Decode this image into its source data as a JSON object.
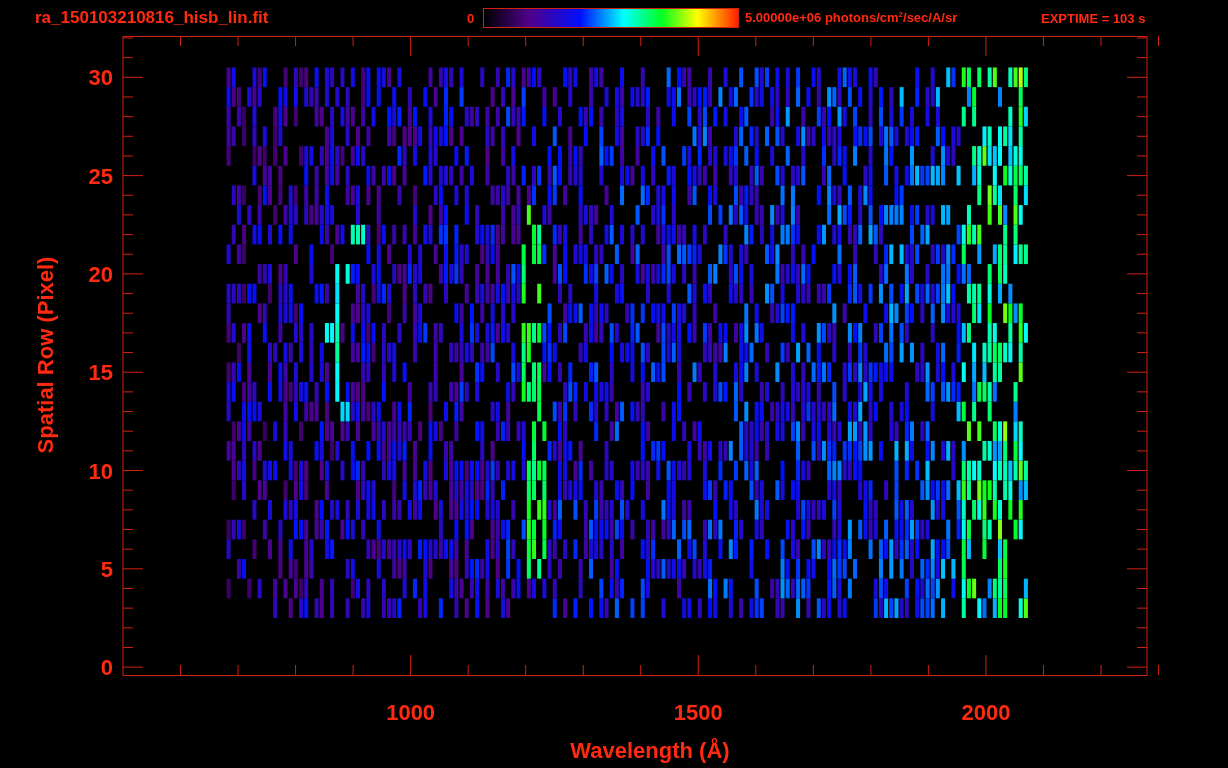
{
  "title": "ra_150103210816_hisb_lin.fit",
  "colorbar": {
    "min_label": "0",
    "max_label": "5.00000e+06 photons/cm$^{2}$/sec/A/sr"
  },
  "exptime": "EXPTIME = 103 s",
  "plot": {
    "x_axis": {
      "label": "Wavelength (Å)",
      "ticks": [
        "1000",
        "1500",
        "2000"
      ]
    },
    "y_axis": {
      "label": "Spatial Row (Pixel)",
      "ticks": [
        "30",
        "25",
        "20",
        "15",
        "10",
        "5",
        "0"
      ]
    }
  }
}
